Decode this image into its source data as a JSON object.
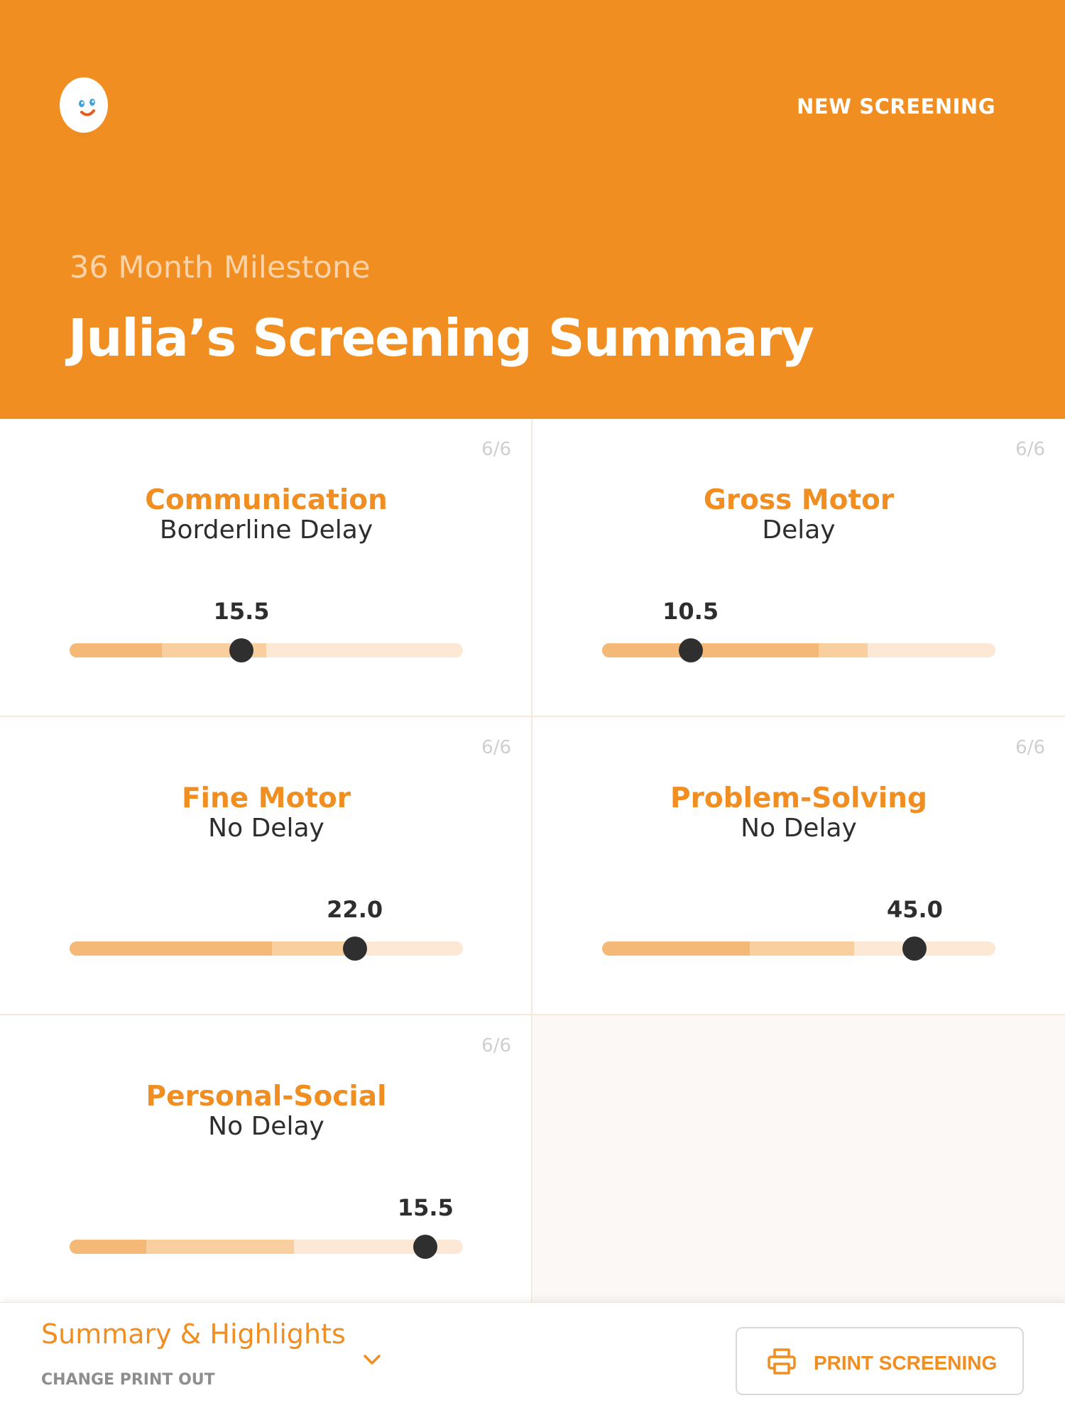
{
  "header": {
    "new_screening_label": "NEW SCREENING",
    "milestone": "36 Month Milestone",
    "title": "Julia’s Screening Summary"
  },
  "colors": {
    "brand_orange": "#F08E21",
    "track_dark": "#F4B976",
    "track_mid": "#F9CFA0",
    "track_light": "#FCE8D5",
    "thumb": "#2F2F2F"
  },
  "domains": [
    {
      "name": "Communication",
      "status": "Borderline Delay",
      "count": "6/6",
      "score_label": "15.5",
      "zones": [
        0.235,
        0.5,
        1.0
      ],
      "position": 0.437
    },
    {
      "name": "Gross Motor",
      "status": "Delay",
      "count": "6/6",
      "score_label": "10.5",
      "zones": [
        0.55,
        0.675,
        1.0
      ],
      "position": 0.225
    },
    {
      "name": "Fine Motor",
      "status": "No Delay",
      "count": "6/6",
      "score_label": "22.0",
      "zones": [
        0.515,
        0.725,
        1.0
      ],
      "position": 0.725
    },
    {
      "name": "Problem-Solving",
      "status": "No Delay",
      "count": "6/6",
      "score_label": "45.0",
      "zones": [
        0.375,
        0.64,
        1.0
      ],
      "position": 0.795
    },
    {
      "name": "Personal-Social",
      "status": "No Delay",
      "count": "6/6",
      "score_label": "15.5",
      "zones": [
        0.195,
        0.57,
        1.0
      ],
      "position": 0.905
    }
  ],
  "footer": {
    "summary_label": "Summary & Highlights",
    "change_label": "CHANGE PRINT OUT",
    "print_label": "PRINT SCREENING",
    "chevron_icon": "chevron-down-icon",
    "print_icon": "printer-icon"
  }
}
